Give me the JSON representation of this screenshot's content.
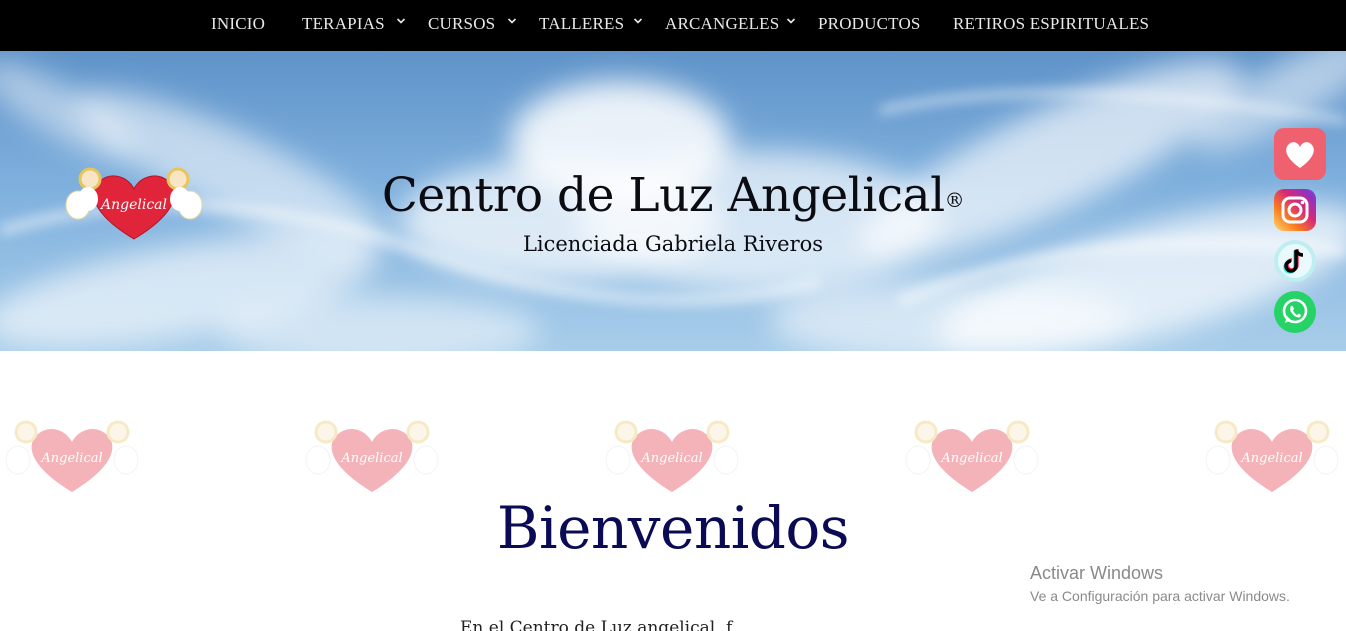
{
  "nav": {
    "items": [
      {
        "label": "INICIO",
        "has_dropdown": false
      },
      {
        "label": "TERAPIAS",
        "has_dropdown": true
      },
      {
        "label": "CURSOS",
        "has_dropdown": true
      },
      {
        "label": "TALLERES",
        "has_dropdown": true
      },
      {
        "label": "ARCANGELES",
        "has_dropdown": true
      },
      {
        "label": "PRODUCTOS",
        "has_dropdown": false
      },
      {
        "label": "RETIROS ESPIRITUALES",
        "has_dropdown": false
      }
    ]
  },
  "hero": {
    "title": "Centro de Luz Angelical",
    "registered_mark": "®",
    "subtitle": "Licenciada Gabriela Riveros",
    "logo_text": "Angelical"
  },
  "social": [
    {
      "name": "favorite-heart-icon",
      "color": "#f0616f"
    },
    {
      "name": "instagram-icon",
      "color": "#d62976"
    },
    {
      "name": "tiktok-icon",
      "color": "#000000"
    },
    {
      "name": "whatsapp-icon",
      "color": "#25d366"
    }
  ],
  "watermark_text": "Angelical",
  "main": {
    "welcome": "Bienvenidos",
    "intro_partial": "En el Centro de Luz angelical, f"
  },
  "windows_activation": {
    "title": "Activar Windows",
    "subtitle": "Ve a Configuración para activar Windows."
  },
  "colors": {
    "nav_bg": "#000000",
    "welcome_text": "#0b0b55",
    "heart_red": "#e0253a"
  }
}
